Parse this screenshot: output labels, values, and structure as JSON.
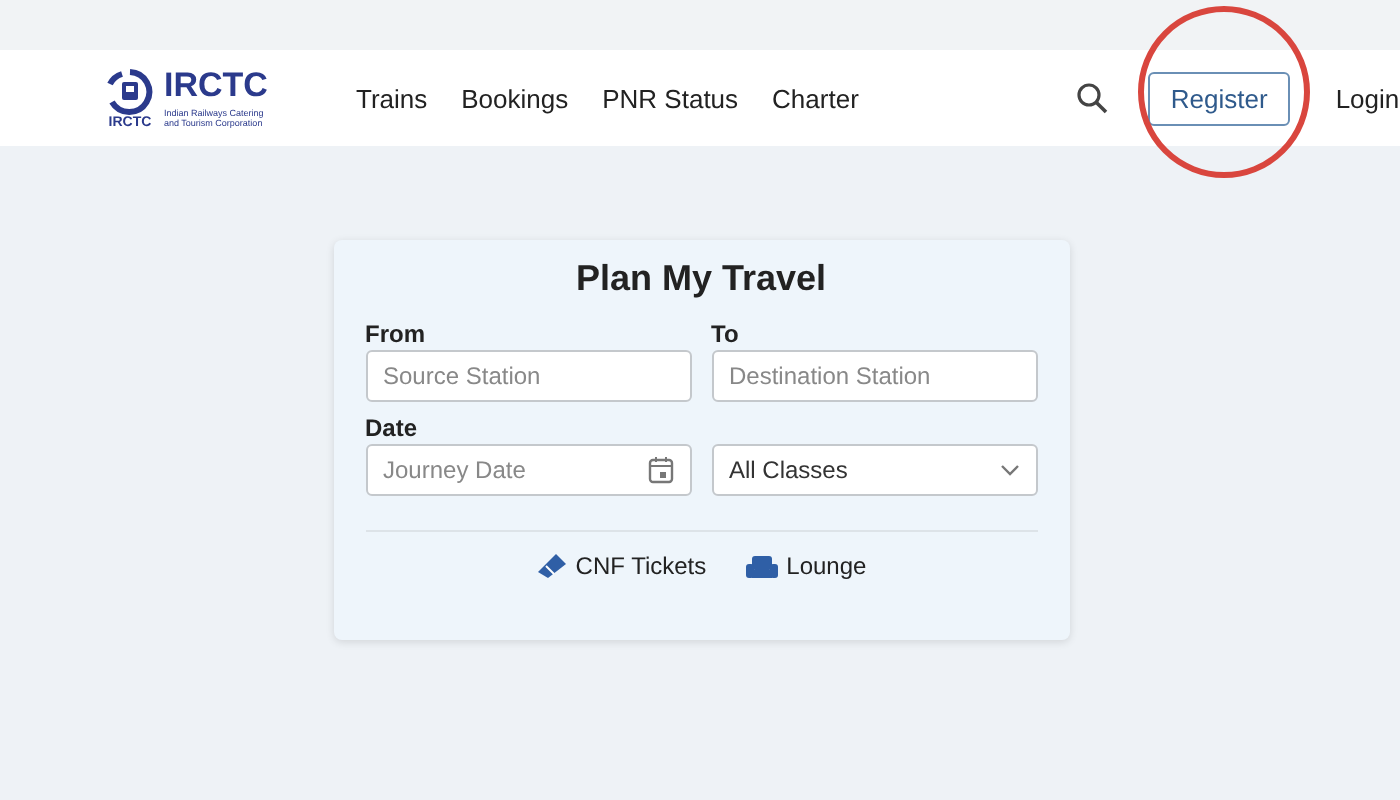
{
  "logo": {
    "name": "IRCTC",
    "emblem_caption": "IRCTC",
    "tagline_lines": [
      "Indian Railways Catering",
      "and Tourism Corporation"
    ]
  },
  "nav": [
    "Trains",
    "Bookings",
    "PNR Status",
    "Charter"
  ],
  "register": {
    "label": "Register",
    "highlighted": true
  },
  "login": "Login",
  "form": {
    "title": "Plan My Travel",
    "fields": [
      {
        "kind": "text",
        "label": "From",
        "placeholder": "Source Station"
      },
      {
        "kind": "text",
        "label": "To",
        "placeholder": "Destination Station"
      },
      {
        "kind": "date",
        "label": "Date",
        "placeholder": "Journey Date"
      },
      {
        "kind": "select",
        "value": "All Classes"
      }
    ],
    "links": [
      {
        "kind": "ticket",
        "label": "CNF Tickets"
      },
      {
        "kind": "lounge",
        "label": "Lounge"
      }
    ]
  }
}
